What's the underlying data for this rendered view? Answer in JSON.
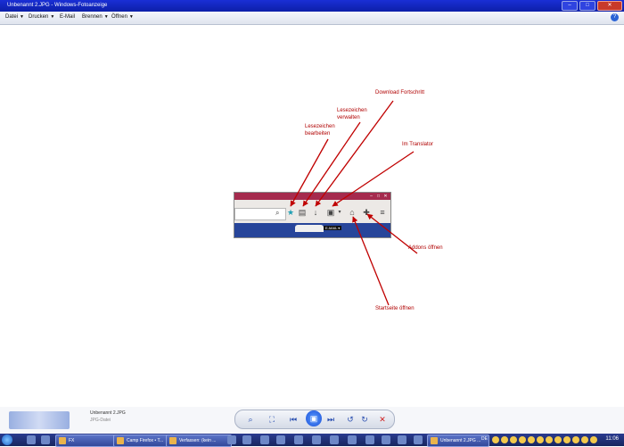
{
  "window": {
    "title": "Unbenannt 2.JPG - Windows-Fotoanzeige"
  },
  "menu": [
    {
      "label": "Datei",
      "has_dropdown": true
    },
    {
      "label": "Drucken",
      "has_dropdown": true
    },
    {
      "label": "E-Mail",
      "has_dropdown": false
    },
    {
      "label": "Brennen",
      "has_dropdown": true
    },
    {
      "label": "Öffnen",
      "has_dropdown": true
    }
  ],
  "annotations": {
    "lesezeichen_bearbeiten": "Lesezeichen bearbeiten",
    "lesezeichen_verwalten": "Lesezeichen verwalten",
    "download_fortschritt": "Download Fortschritt",
    "im_translator": "Im Translator",
    "addons_oeffnen": "Addons öffnen",
    "startseite_oeffnen": "Startseite öffnen"
  },
  "info": {
    "filename": "Unbenannt 2.JPG",
    "filetype": "JPG-Datei"
  },
  "taskbar": {
    "windows": [
      {
        "label": "FX"
      },
      {
        "label": "Camp Firefox • T..."
      },
      {
        "label": "Verfassen: (kein ..."
      },
      {
        "label": "Unbenannt 2.JPG ..."
      }
    ],
    "language": "DE",
    "clock": "11:06"
  },
  "colors": {
    "titlebar": "#1a2fd6",
    "annotation": "#b00000",
    "taskbar": "#17265f"
  }
}
